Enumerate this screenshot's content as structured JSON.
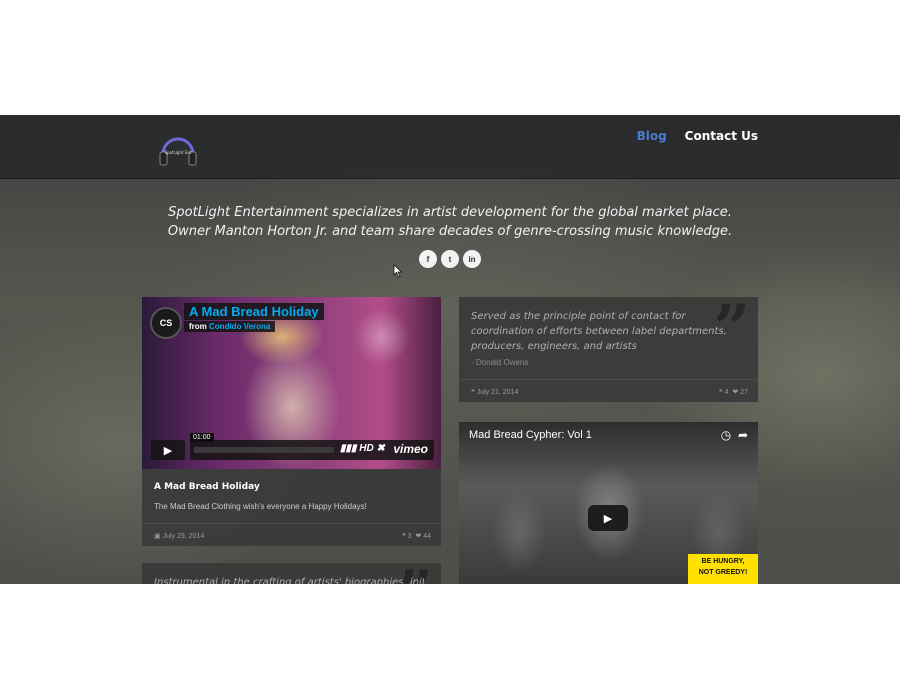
{
  "nav": {
    "logo_text": "SpotLight Ent",
    "items": [
      {
        "label": "Blog",
        "active": true
      },
      {
        "label": "Contact Us",
        "active": false
      }
    ]
  },
  "hero": {
    "tagline": "SpotLight Entertainment specializes in artist development for the global market place. Owner Manton Horton Jr. and team share decades of genre-crossing music knowledge.",
    "socials": [
      {
        "icon": "facebook-icon",
        "glyph": "f"
      },
      {
        "icon": "twitter-icon",
        "glyph": "t"
      },
      {
        "icon": "linkedin-icon",
        "glyph": "in"
      }
    ]
  },
  "posts": {
    "video_post": {
      "player": {
        "title": "A Mad Bread Holiday",
        "from_prefix": "from",
        "from_name": "Condido Verona",
        "avatar_text": "CS",
        "time": "01:00",
        "hd": "HD",
        "brand": "vimeo"
      },
      "title": "A Mad Bread Holiday",
      "description": "The Mad Bread Clothing wish's everyone a Happy Holidays!",
      "date": "July 29, 2014",
      "comments": "3",
      "likes": "44"
    },
    "quote_post": {
      "quote": "Served as the principle point of contact for coordination of efforts between label departments, producers, engineers, and artists",
      "author": "- Donald Owens",
      "date": "July 21, 2014",
      "comments": "4",
      "likes": "27"
    },
    "youtube_post": {
      "title": "Mad Bread Cypher: Vol 1",
      "badge_line1": "BE HUNGRY,",
      "badge_line2": "NOT GREEDY!"
    },
    "partial_post": {
      "quote": "Instrumental in the crafting of artists' biographies, initial drafts"
    }
  },
  "colors": {
    "nav_active": "#4a7bd0",
    "vimeo_blue": "#00adef",
    "badge_yellow": "#ffe000"
  }
}
